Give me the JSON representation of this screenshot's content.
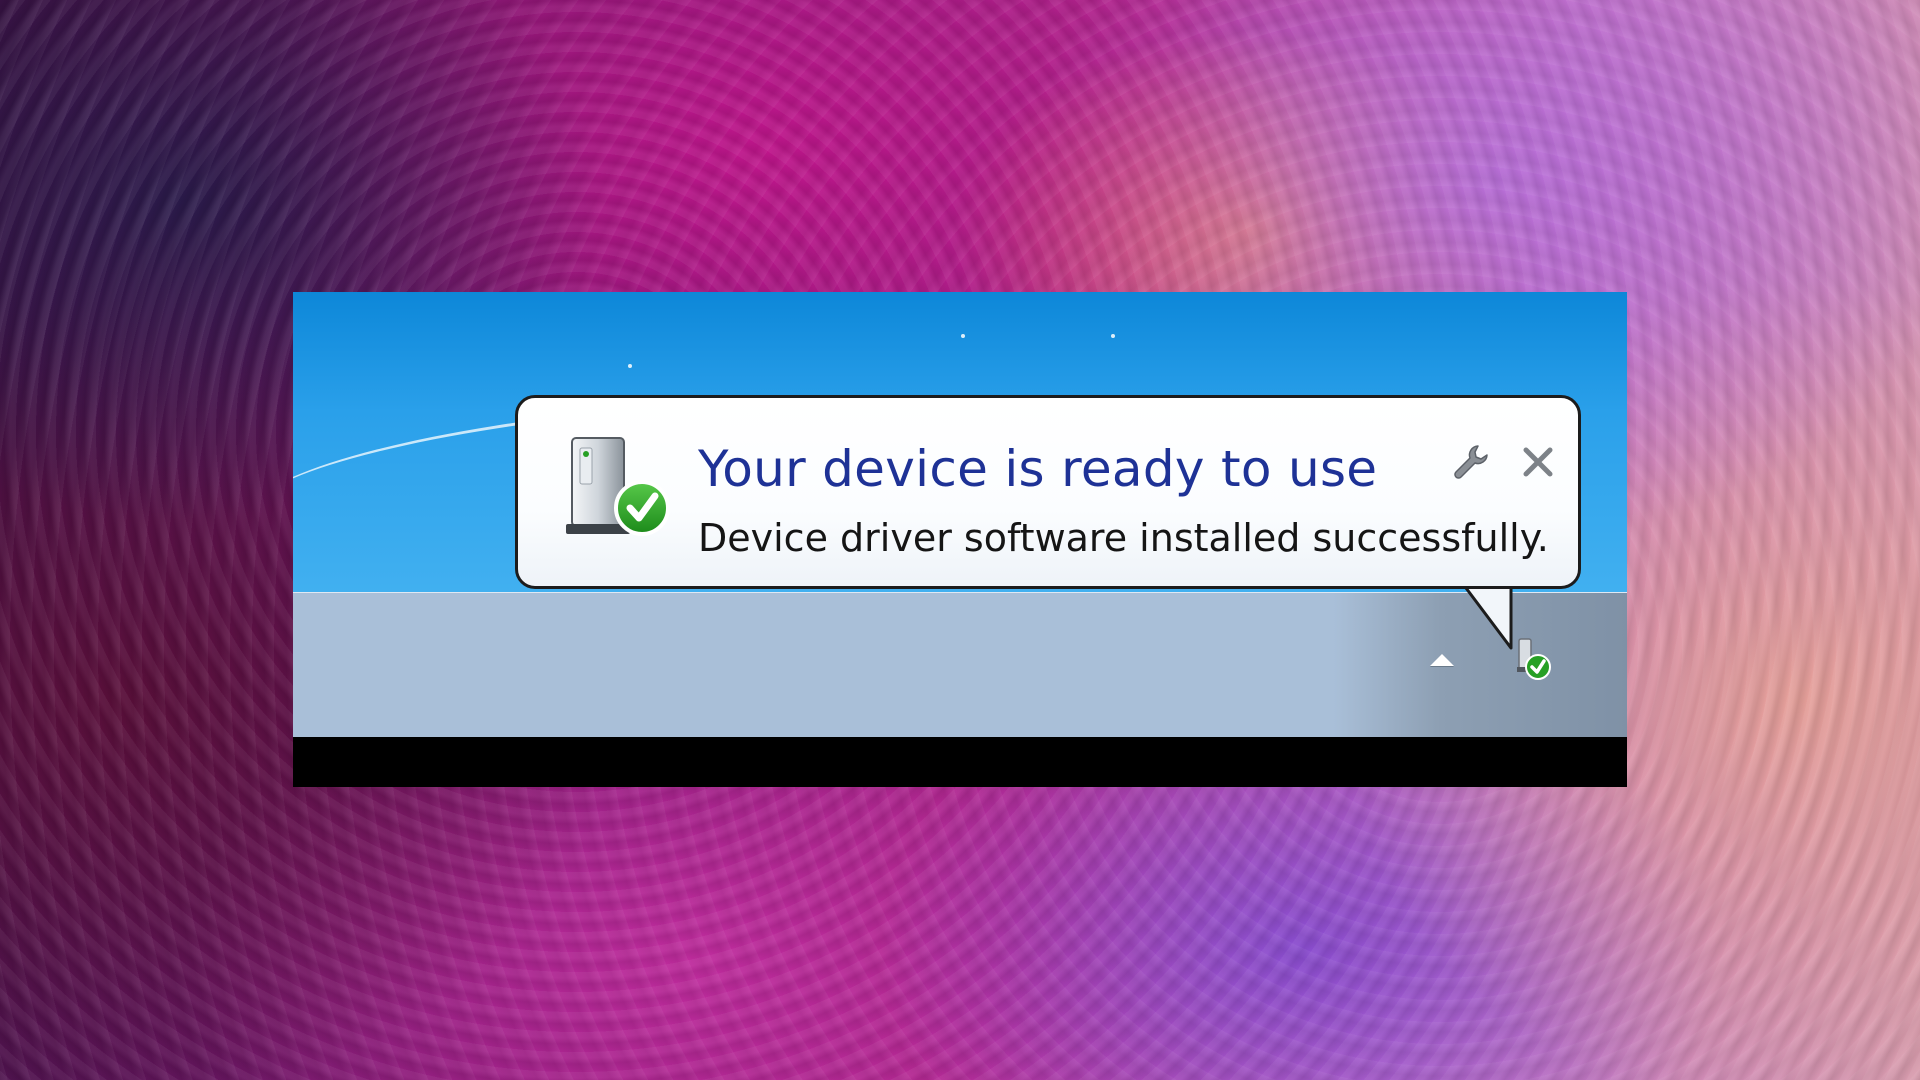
{
  "notification": {
    "title": "Your device is ready to use",
    "message": "Device driver software installed successfully.",
    "icon": "device-installed-icon",
    "options_icon": "wrench-icon",
    "close_icon": "close-icon"
  },
  "taskbar": {
    "show_hidden_icon": "chevron-up-icon",
    "tray_icon": "device-installed-icon"
  },
  "colors": {
    "title": "#1e3296",
    "message": "#151515",
    "desktop": "#2aa0ea",
    "taskbar": "#a9bfd8",
    "check_green": "#27a025"
  }
}
